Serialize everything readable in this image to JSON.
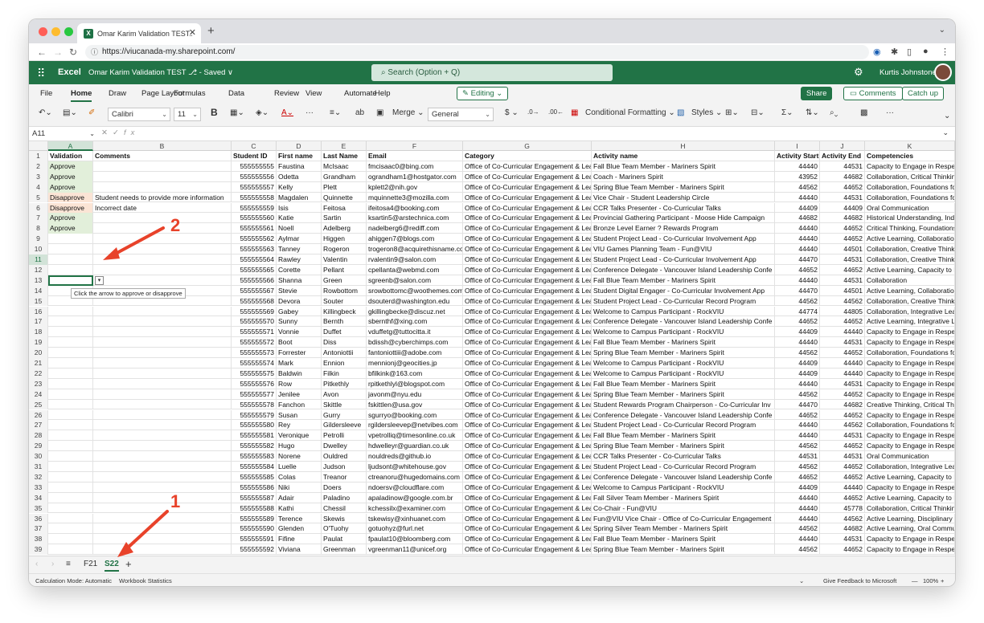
{
  "browser": {
    "tab_title": "Omar Karim Validation TEST.xlsx",
    "tab_icon": "excel-icon",
    "url": "https://viucanada-my.sharepoint.com/"
  },
  "app": {
    "brand": "Excel",
    "doc_title": "Omar Karim Validation TEST ⎇ - Saved ∨",
    "search_placeholder": "Search (Option + Q)",
    "user_name": "Kurtis Johnstone"
  },
  "ribbon": {
    "tabs": [
      "File",
      "Home",
      "Draw",
      "Page Layout",
      "Formulas",
      "Data",
      "Review",
      "View",
      "Automate",
      "Help"
    ],
    "active_tab": "Home",
    "editing_label": "Editing",
    "share_label": "Share",
    "comments_label": "Comments",
    "catchup_label": "Catch up",
    "font_name": "Calibri",
    "font_size": "11",
    "bold_label": "B",
    "merge_label": "Merge",
    "number_format": "General",
    "currency_label": "$",
    "conditional_label": "Conditional Formatting",
    "styles_label": "Styles"
  },
  "formula_bar": {
    "name_box": "A11",
    "fx_label": "fx",
    "formula": ""
  },
  "columns": [
    "A",
    "B",
    "C",
    "D",
    "E",
    "F",
    "G",
    "H",
    "I",
    "J",
    "K"
  ],
  "headers": [
    "Validation",
    "Comments",
    "Student ID",
    "First name",
    "Last Name",
    "Email",
    "Category",
    "Activity name",
    "Activity Start",
    "Activity End",
    "Competencies"
  ],
  "rows": [
    [
      "Approve",
      "",
      "555555555",
      "Faustina",
      "McIsaac",
      "fmcisaac0@bing.com",
      "Office of Co-Curricular Engagement & Lear",
      "Fall Blue Team Member - Mariners Spirit",
      "44440",
      "44531",
      "Capacity to Engage in Respec"
    ],
    [
      "Approve",
      "",
      "555555556",
      "Odetta",
      "Grandham",
      "ograndham1@hostgator.com",
      "Office of Co-Curricular Engagement & Lear",
      "Coach - Mariners Spirit",
      "43952",
      "44682",
      "Collaboration, Critical Thinkin"
    ],
    [
      "Approve",
      "",
      "555555557",
      "Kelly",
      "Plett",
      "kplett2@nih.gov",
      "Office of Co-Curricular Engagement & Lear",
      "Spring Blue Team Member - Mariners Spirit",
      "44562",
      "44652",
      "Collaboration, Foundations fc"
    ],
    [
      "Disapprove",
      "Student needs to provide more information",
      "555555558",
      "Magdalen",
      "Quinnette",
      "mquinnette3@mozilla.com",
      "Office of Co-Curricular Engagement & Lear",
      "Vice Chair - Student Leadership Circle",
      "44440",
      "44531",
      "Collaboration, Foundations fc"
    ],
    [
      "Disapprove",
      "Incorrect date",
      "555555559",
      "Isis",
      "Feitosa",
      "ifeitosa4@booking.com",
      "Office of Co-Curricular Engagement & Lear",
      "CCR Talks Presenter - Co-Curricular Talks",
      "44409",
      "44409",
      "Oral Communication"
    ],
    [
      "Approve",
      "",
      "555555560",
      "Katie",
      "Sartin",
      "ksartin5@arstechnica.com",
      "Office of Co-Curricular Engagement & Lear",
      "Provincial Gathering Participant - Moose Hide Campaign",
      "44682",
      "44682",
      "Historical Understanding, Ind"
    ],
    [
      "Approve",
      "",
      "555555561",
      "Noell",
      "Adelberg",
      "nadelberg6@rediff.com",
      "Office of Co-Curricular Engagement & Lear",
      "Bronze Level Earner ? Rewards Program",
      "44440",
      "44652",
      "Critical Thinking, Foundations"
    ],
    [
      "",
      "",
      "555555562",
      "Aylmar",
      "Higgen",
      "ahiggen7@blogs.com",
      "Office of Co-Curricular Engagement & Lear",
      "Student Project Lead - Co-Curricular Involvement App",
      "44440",
      "44652",
      "Active Learning, Collaboratio"
    ],
    [
      "",
      "",
      "555555563",
      "Tanney",
      "Rogeron",
      "trogeron8@acquirethisname.co",
      "Office of Co-Curricular Engagement & Lear",
      "VIU Games Planning Team - Fun@VIU",
      "44440",
      "44501",
      "Collaboration, Creative Think"
    ],
    [
      "",
      "",
      "555555564",
      "Rawley",
      "Valentin",
      "rvalentin9@salon.com",
      "Office of Co-Curricular Engagement & Lear",
      "Student Project Lead - Co-Curricular Involvement App",
      "44470",
      "44531",
      "Collaboration, Creative Think"
    ],
    [
      "",
      "",
      "555555565",
      "Corette",
      "Pellant",
      "cpellanta@webmd.com",
      "Office of Co-Curricular Engagement & Lear",
      "Conference Delegate - Vancouver Island Leadership Confe",
      "44652",
      "44652",
      "Active Learning, Capacity to E"
    ],
    [
      "",
      "",
      "555555566",
      "Shanna",
      "Green",
      "sgreenb@salon.com",
      "Office of Co-Curricular Engagement & Lear",
      "Fall Blue Team Member - Mariners Spirit",
      "44440",
      "44531",
      "Collaboration"
    ],
    [
      "",
      "",
      "555555567",
      "Stevie",
      "Rowbottom",
      "srowbottomc@woothemes.com",
      "Office of Co-Curricular Engagement & Lear",
      "Student Digital Engager - Co-Curricular Involvement App",
      "44470",
      "44501",
      "Active Learning, Collaboratio"
    ],
    [
      "",
      "",
      "555555568",
      "Devora",
      "Souter",
      "dsouterd@washington.edu",
      "Office of Co-Curricular Engagement & Lear",
      "Student Project Lead - Co-Curricular Record Program",
      "44562",
      "44562",
      "Collaboration, Creative Think"
    ],
    [
      "",
      "",
      "555555569",
      "Gabey",
      "Killingbeck",
      "gkillingbecke@discuz.net",
      "Office of Co-Curricular Engagement & Lear",
      "Welcome to Campus Participant - RockVIU",
      "44774",
      "44805",
      "Collaboration, Integrative Lea"
    ],
    [
      "",
      "",
      "555555570",
      "Sunny",
      "Bernth",
      "sbernthf@xing.com",
      "Office of Co-Curricular Engagement & Lear",
      "Conference Delegate - Vancouver Island Leadership Confe",
      "44652",
      "44652",
      "Active Learning, Integrative L"
    ],
    [
      "",
      "",
      "555555571",
      "Vonnie",
      "Duffet",
      "vduffetg@tuttocitta.it",
      "Office of Co-Curricular Engagement & Lear",
      "Welcome to Campus Participant - RockVIU",
      "44409",
      "44440",
      "Capacity to Engage in Respec"
    ],
    [
      "",
      "",
      "555555572",
      "Boot",
      "Diss",
      "bdissh@cyberchimps.com",
      "Office of Co-Curricular Engagement & Lear",
      "Fall Blue Team Member - Mariners Spirit",
      "44440",
      "44531",
      "Capacity to Engage in Respec"
    ],
    [
      "",
      "",
      "555555573",
      "Forrester",
      "Antoniottii",
      "fantoniottiii@adobe.com",
      "Office of Co-Curricular Engagement & Lear",
      "Spring Blue Team Member - Mariners Spirit",
      "44562",
      "44652",
      "Collaboration, Foundations fc"
    ],
    [
      "",
      "",
      "555555574",
      "Mark",
      "Ennion",
      "mennionj@geocities.jp",
      "Office of Co-Curricular Engagement & Lear",
      "Welcome to Campus Participant - RockVIU",
      "44409",
      "44440",
      "Capacity to Engage in Respec"
    ],
    [
      "",
      "",
      "555555575",
      "Baldwin",
      "Filkin",
      "bfilkink@163.com",
      "Office of Co-Curricular Engagement & Lear",
      "Welcome to Campus Participant - RockVIU",
      "44409",
      "44440",
      "Capacity to Engage in Respec"
    ],
    [
      "",
      "",
      "555555576",
      "Row",
      "Pitkethly",
      "rpitkethlyl@blogspot.com",
      "Office of Co-Curricular Engagement & Lear",
      "Fall Blue Team Member - Mariners Spirit",
      "44440",
      "44531",
      "Capacity to Engage in Respec"
    ],
    [
      "",
      "",
      "555555577",
      "Jenilee",
      "Avon",
      "javonm@nyu.edu",
      "Office of Co-Curricular Engagement & Lear",
      "Spring Blue Team Member - Mariners Spirit",
      "44562",
      "44652",
      "Capacity to Engage in Respec"
    ],
    [
      "",
      "",
      "555555578",
      "Fanchon",
      "Skittle",
      "fskittlen@usa.gov",
      "Office of Co-Curricular Engagement & Lear",
      "Student Rewards Program Chairperson - Co-Curricular Inv",
      "44470",
      "44682",
      "Creative Thinking, Critical Thi"
    ],
    [
      "",
      "",
      "555555579",
      "Susan",
      "Gurry",
      "sgurryo@booking.com",
      "Office of Co-Curricular Engagement & Lear",
      "Conference Delegate - Vancouver Island Leadership Confe",
      "44652",
      "44652",
      "Capacity to Engage in Respec"
    ],
    [
      "",
      "",
      "555555580",
      "Rey",
      "Gildersleeve",
      "rgildersleevep@netvibes.com",
      "Office of Co-Curricular Engagement & Lear",
      "Student Project Lead - Co-Curricular Record Program",
      "44440",
      "44562",
      "Collaboration, Foundations fc"
    ],
    [
      "",
      "",
      "555555581",
      "Veronique",
      "Petrolli",
      "vpetrolliq@timesonline.co.uk",
      "Office of Co-Curricular Engagement & Lear",
      "Fall Blue Team Member - Mariners Spirit",
      "44440",
      "44531",
      "Capacity to Engage in Respec"
    ],
    [
      "",
      "",
      "555555582",
      "Hugo",
      "Dwelley",
      "hdwelleyr@guardian.co.uk",
      "Office of Co-Curricular Engagement & Lear",
      "Spring Blue Team Member - Mariners Spirit",
      "44562",
      "44652",
      "Capacity to Engage in Respec"
    ],
    [
      "",
      "",
      "555555583",
      "Norene",
      "Ouldred",
      "nouldreds@github.io",
      "Office of Co-Curricular Engagement & Lear",
      "CCR Talks Presenter - Co-Curricular Talks",
      "44531",
      "44531",
      "Oral Communication"
    ],
    [
      "",
      "",
      "555555584",
      "Luelle",
      "Judson",
      "ljudsont@whitehouse.gov",
      "Office of Co-Curricular Engagement & Lear",
      "Student Project Lead - Co-Curricular Record Program",
      "44562",
      "44652",
      "Collaboration, Integrative Lea"
    ],
    [
      "",
      "",
      "555555585",
      "Colas",
      "Treanor",
      "ctreanoru@hugedomains.com",
      "Office of Co-Curricular Engagement & Lear",
      "Conference Delegate - Vancouver Island Leadership Confe",
      "44652",
      "44652",
      "Active Learning, Capacity to E"
    ],
    [
      "",
      "",
      "555555586",
      "Niki",
      "Doers",
      "ndoersv@cloudflare.com",
      "Office of Co-Curricular Engagement & Lear",
      "Welcome to Campus Participant - RockVIU",
      "44409",
      "44440",
      "Capacity to Engage in Respec"
    ],
    [
      "",
      "",
      "555555587",
      "Adair",
      "Paladino",
      "apaladinow@google.com.br",
      "Office of Co-Curricular Engagement & Lear",
      "Fall Silver Team Member - Mariners Spirit",
      "44440",
      "44652",
      "Active Learning, Capacity to E"
    ],
    [
      "",
      "",
      "555555588",
      "Kathi",
      "Chessil",
      "kchessilx@examiner.com",
      "Office of Co-Curricular Engagement & Lear",
      "Co-Chair - Fun@VIU",
      "44440",
      "45778",
      "Collaboration, Critical Thinkin"
    ],
    [
      "",
      "",
      "555555589",
      "Terence",
      "Skewis",
      "tskewisy@xinhuanet.com",
      "Office of Co-Curricular Engagement & Lear",
      "Fun@VIU Vice Chair - Office of Co-Curricular Engagement",
      "44440",
      "44562",
      "Active Learning, Disciplinary I"
    ],
    [
      "",
      "",
      "555555590",
      "Glenden",
      "O'Tuohy",
      "gotuohyz@furl.net",
      "Office of Co-Curricular Engagement & Lear",
      "Spring Silver Team Member - Mariners Spirit",
      "44562",
      "44682",
      "Active Learning, Oral Commu"
    ],
    [
      "",
      "",
      "555555591",
      "Fifine",
      "Paulat",
      "fpaulat10@bloomberg.com",
      "Office of Co-Curricular Engagement & Lear",
      "Fall Blue Team Member - Mariners Spirit",
      "44440",
      "44531",
      "Capacity to Engage in Respec"
    ],
    [
      "",
      "",
      "555555592",
      "Viviana",
      "Greenman",
      "vgreenman11@unicef.org",
      "Office of Co-Curricular Engagement & Lear",
      "Spring Blue Team Member - Mariners Spirit",
      "44562",
      "44652",
      "Capacity to Engage in Respec"
    ]
  ],
  "validation_tooltip": "Click the arrow to approve or disapprove",
  "sheets": [
    "F21",
    "S22"
  ],
  "active_sheet": "S22",
  "status": {
    "calc_mode": "Calculation Mode: Automatic",
    "workbook_stats": "Workbook Statistics",
    "feedback": "Give Feedback to Microsoft",
    "zoom": "100%"
  },
  "annotations": [
    "1",
    "2"
  ],
  "colors": {
    "excel_green": "#217346",
    "approve_fill": "#e2efda",
    "disapprove_fill": "#fbe4d5",
    "arrow_red": "#e8422a"
  }
}
